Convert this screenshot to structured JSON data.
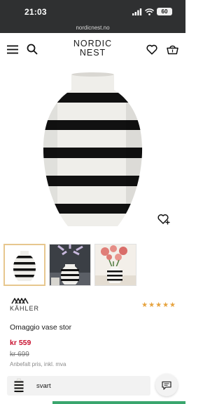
{
  "status_bar": {
    "time": "21:03",
    "battery": "60",
    "icons": [
      "signal-icon",
      "wifi-icon"
    ]
  },
  "browser": {
    "url": "nordicnest.no"
  },
  "header": {
    "logo_line1": "NORDIC",
    "logo_line2": "NEST",
    "icons": [
      "menu-icon",
      "search-icon",
      "heart-icon",
      "basket-icon"
    ]
  },
  "gallery": {
    "thumbnails": [
      "vase",
      "vase-with-flowers",
      "vase-with-red-flowers"
    ],
    "selected_index": 0
  },
  "product": {
    "brand": "KÄHLER",
    "rating": "★★★★★",
    "name": "Omaggio vase stor",
    "price": "kr 559",
    "old_price": "kr 699",
    "price_note": "Anbefalt pris, inkl. mva",
    "variant": "svart"
  },
  "colors": {
    "accent": "#c8102e",
    "star": "#e6a23c",
    "selected_border": "#e7c78e",
    "browser_bar": "#2f3031"
  }
}
